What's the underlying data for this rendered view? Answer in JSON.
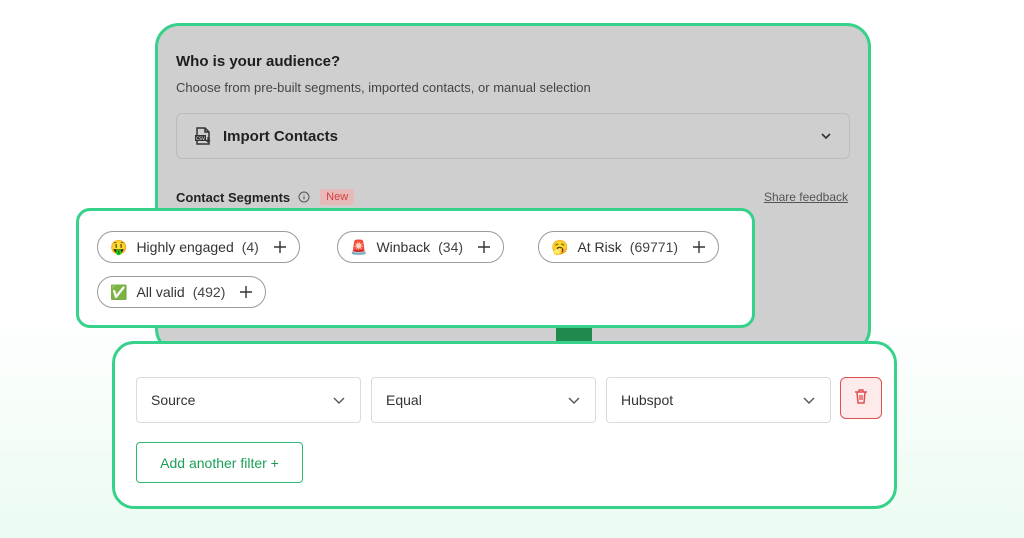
{
  "audience": {
    "title": "Who is your audience?",
    "subtitle": "Choose from pre-built segments, imported contacts, or manual selection",
    "import_dropdown": {
      "label": "Import Contacts",
      "icon": "csv-file-icon"
    }
  },
  "segments_header": {
    "label": "Contact Segments",
    "badge": "New",
    "share_feedback": "Share feedback"
  },
  "segments": [
    {
      "emoji": "🤑",
      "label": "Highly engaged",
      "count": "(4)"
    },
    {
      "emoji": "🚨",
      "label": "Winback",
      "count": "(34)"
    },
    {
      "emoji": "🥱",
      "label": "At Risk",
      "count": "(69771)"
    },
    {
      "emoji": "✅",
      "label": "All valid",
      "count": "(492)"
    }
  ],
  "filter": {
    "field": "Source",
    "operator": "Equal",
    "value": "Hubspot",
    "add_button": "Add another filter +"
  },
  "colors": {
    "accent_green": "#36d18a",
    "danger_red": "#e05050",
    "badge_red": "#d63d3d"
  }
}
